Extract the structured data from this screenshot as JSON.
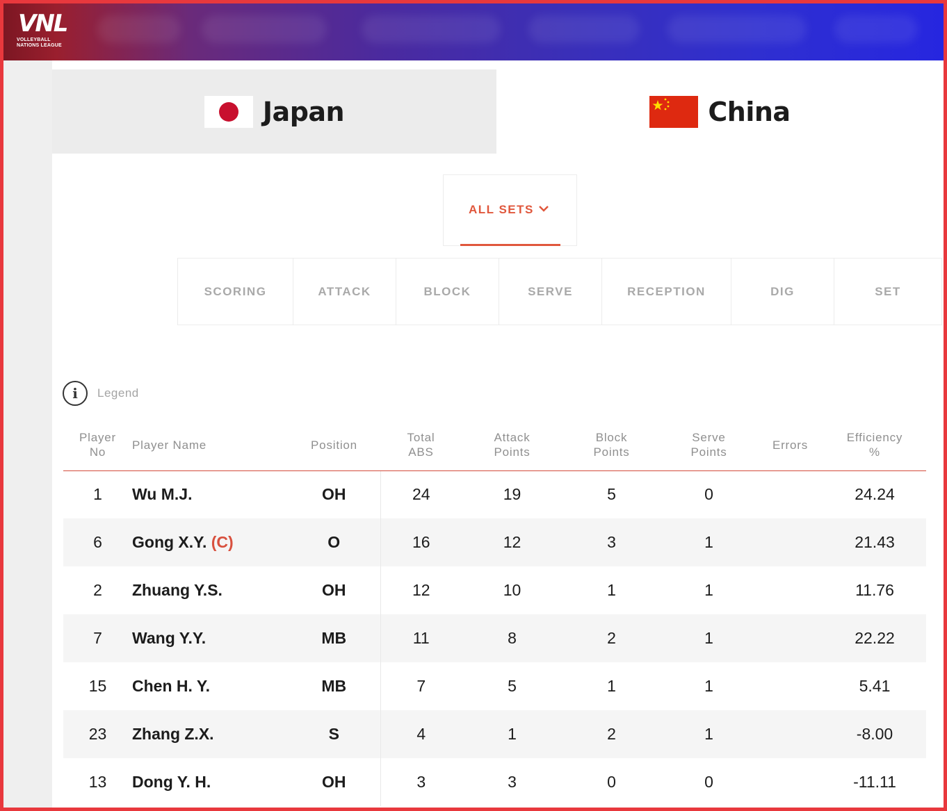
{
  "header": {
    "logo_text": "VNL",
    "logo_sub": "VOLLEYBALL NATIONS LEAGUE"
  },
  "teams": [
    {
      "name": "Japan",
      "flag": "japan-flag",
      "selected": false
    },
    {
      "name": "China",
      "flag": "china-flag",
      "selected": true
    }
  ],
  "sets_filter": {
    "label": "ALL SETS"
  },
  "stat_tabs": [
    "SCORING",
    "ATTACK",
    "BLOCK",
    "SERVE",
    "RECEPTION",
    "DIG",
    "SET"
  ],
  "legend": {
    "label": "Legend"
  },
  "table": {
    "headers": {
      "player_no": [
        "Player",
        "No"
      ],
      "player_name": "Player Name",
      "position": "Position",
      "total_abs": [
        "Total",
        "ABS"
      ],
      "attack_points": [
        "Attack",
        "Points"
      ],
      "block_points": [
        "Block",
        "Points"
      ],
      "serve_points": [
        "Serve",
        "Points"
      ],
      "errors": "Errors",
      "efficiency": [
        "Efficiency",
        "%"
      ]
    },
    "rows": [
      {
        "no": "1",
        "name": "Wu M.J.",
        "captain": "",
        "position": "OH",
        "total_abs": "24",
        "attack": "19",
        "block": "5",
        "serve": "0",
        "errors": "",
        "efficiency": "24.24"
      },
      {
        "no": "6",
        "name": "Gong X.Y.",
        "captain": "(C)",
        "position": "O",
        "total_abs": "16",
        "attack": "12",
        "block": "3",
        "serve": "1",
        "errors": "",
        "efficiency": "21.43"
      },
      {
        "no": "2",
        "name": "Zhuang Y.S.",
        "captain": "",
        "position": "OH",
        "total_abs": "12",
        "attack": "10",
        "block": "1",
        "serve": "1",
        "errors": "",
        "efficiency": "11.76"
      },
      {
        "no": "7",
        "name": "Wang Y.Y.",
        "captain": "",
        "position": "MB",
        "total_abs": "11",
        "attack": "8",
        "block": "2",
        "serve": "1",
        "errors": "",
        "efficiency": "22.22"
      },
      {
        "no": "15",
        "name": "Chen H. Y.",
        "captain": "",
        "position": "MB",
        "total_abs": "7",
        "attack": "5",
        "block": "1",
        "serve": "1",
        "errors": "",
        "efficiency": "5.41"
      },
      {
        "no": "23",
        "name": "Zhang Z.X.",
        "captain": "",
        "position": "S",
        "total_abs": "4",
        "attack": "1",
        "block": "2",
        "serve": "1",
        "errors": "",
        "efficiency": "-8.00"
      },
      {
        "no": "13",
        "name": "Dong Y. H.",
        "captain": "",
        "position": "OH",
        "total_abs": "3",
        "attack": "3",
        "block": "0",
        "serve": "0",
        "errors": "",
        "efficiency": "-11.11"
      }
    ]
  },
  "colors": {
    "accent": "#e0573c",
    "frame_border": "#e8383d",
    "japan_red": "#c8102e",
    "china_red": "#de2910",
    "china_star": "#ffde00"
  }
}
